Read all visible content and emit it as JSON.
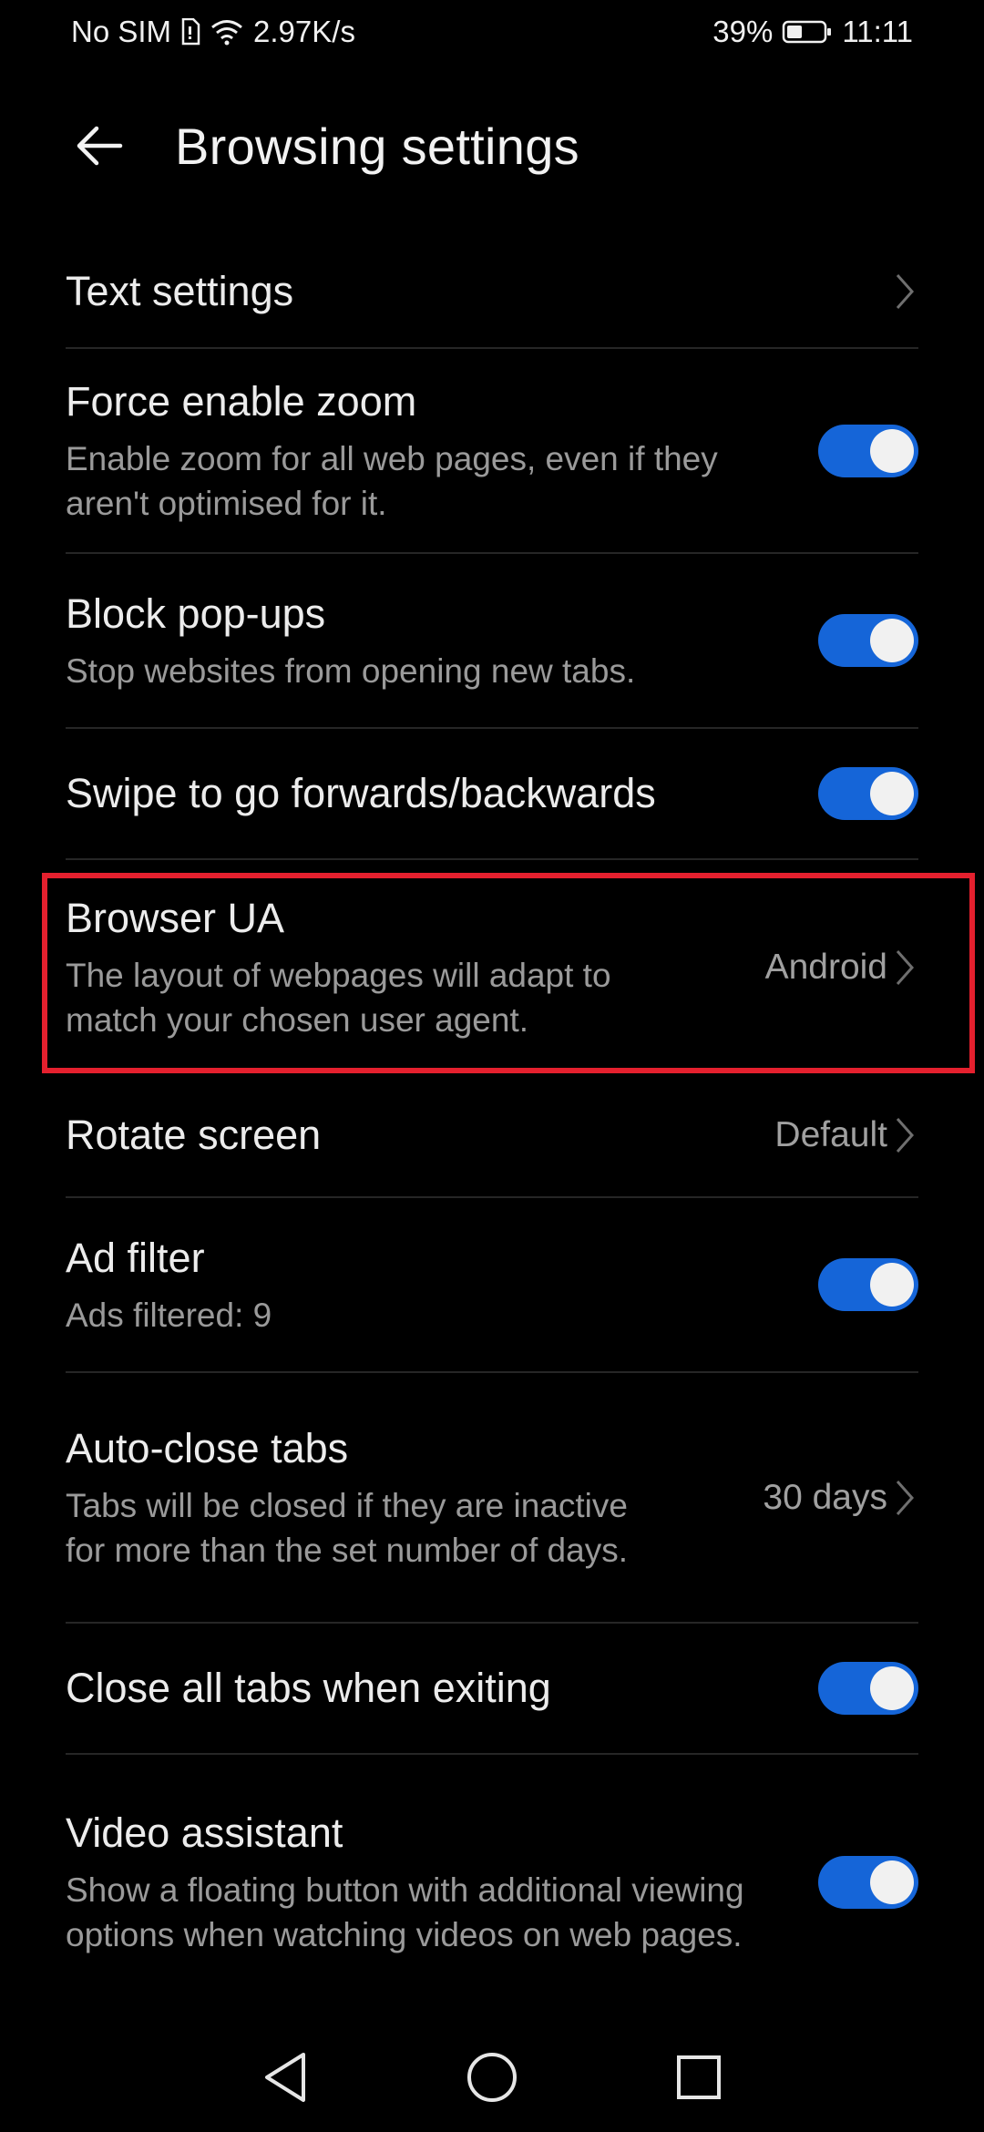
{
  "status_bar": {
    "carrier": "No SIM",
    "speed": "2.97K/s",
    "battery": "39%",
    "time": "11:11"
  },
  "header": {
    "title": "Browsing settings"
  },
  "settings": {
    "text_settings": {
      "title": "Text settings"
    },
    "force_zoom": {
      "title": "Force enable zoom",
      "subtitle": "Enable zoom for all web pages, even if they aren't optimised for it.",
      "enabled": true
    },
    "block_popups": {
      "title": "Block pop-ups",
      "subtitle": "Stop websites from opening new tabs.",
      "enabled": true
    },
    "swipe_nav": {
      "title": "Swipe to go forwards/backwards",
      "enabled": true
    },
    "browser_ua": {
      "title": "Browser UA",
      "subtitle": "The layout of webpages will adapt to match your chosen user agent.",
      "value": "Android"
    },
    "rotate_screen": {
      "title": "Rotate screen",
      "value": "Default"
    },
    "ad_filter": {
      "title": "Ad filter",
      "subtitle": "Ads filtered: 9",
      "enabled": true
    },
    "auto_close_tabs": {
      "title": "Auto-close tabs",
      "subtitle": "Tabs will be closed if they are inactive for more than the set number of days.",
      "value": "30 days"
    },
    "close_tabs_exit": {
      "title": "Close all tabs when exiting",
      "enabled": true
    },
    "video_assistant": {
      "title": "Video assistant",
      "subtitle": "Show a floating button with additional viewing options when watching videos on web pages.",
      "enabled": true
    }
  },
  "colors": {
    "accent": "#1565d8",
    "highlight": "#e5202e",
    "background": "#000000"
  }
}
